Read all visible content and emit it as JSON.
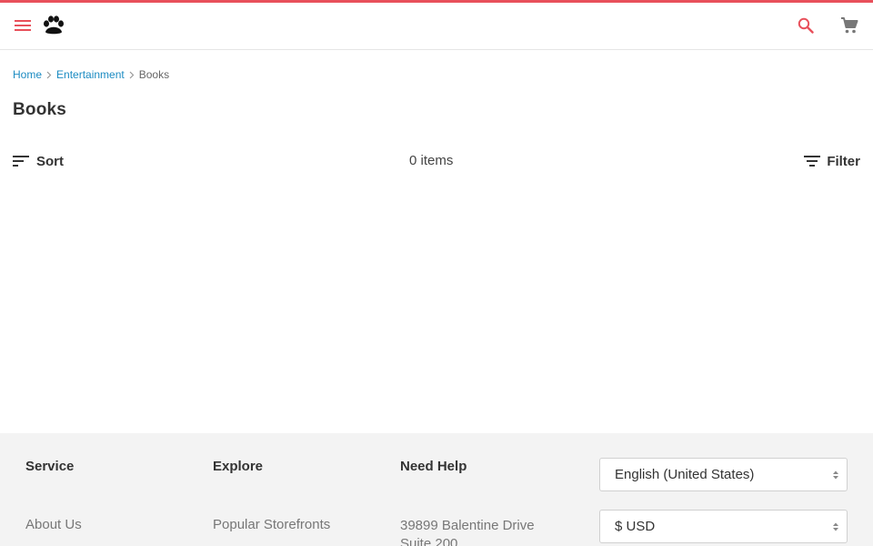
{
  "header": {
    "menu_icon": "hamburger-menu-icon",
    "logo_icon": "paw-logo-icon",
    "search_icon": "search-icon",
    "cart_icon": "shopping-cart-icon",
    "accent_color": "#e8505b"
  },
  "breadcrumb": {
    "items": [
      {
        "label": "Home"
      },
      {
        "label": "Entertainment"
      }
    ],
    "current": "Books",
    "link_color": "#1b8bc2"
  },
  "page": {
    "title": "Books"
  },
  "toolbar": {
    "sort_label": "Sort",
    "item_count": "0 items",
    "filter_label": "Filter"
  },
  "footer": {
    "columns": [
      {
        "heading": "Service",
        "first_link": "About Us"
      },
      {
        "heading": "Explore",
        "first_link": "Popular Storefronts"
      },
      {
        "heading": "Need Help",
        "address_line1": "39899 Balentine Drive",
        "address_line2": "Suite 200"
      }
    ],
    "language_select": {
      "value": "English (United States)"
    },
    "currency_select": {
      "value": "$ USD"
    }
  }
}
